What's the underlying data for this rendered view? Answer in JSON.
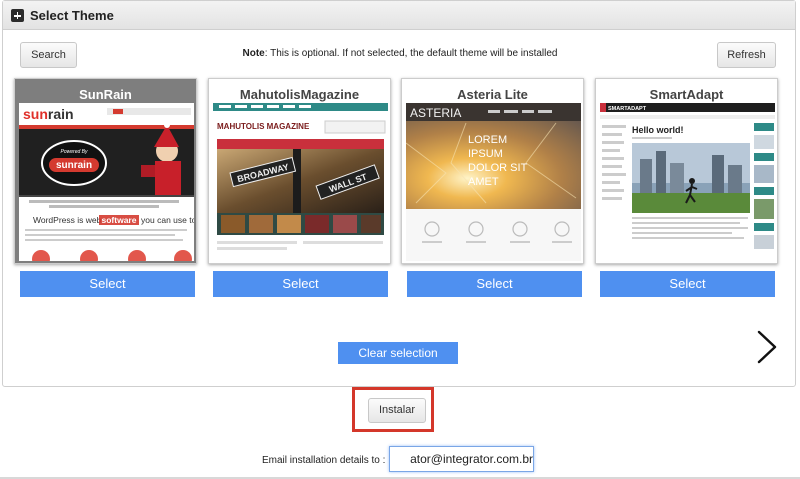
{
  "panel": {
    "title": "Select Theme"
  },
  "toolbar": {
    "search_label": "Search",
    "refresh_label": "Refresh",
    "note_label": "Note",
    "note_text": ": This is optional. If not selected, the default theme will be installed"
  },
  "themes": [
    {
      "name": "SunRain",
      "select_label": "Select",
      "selected": true,
      "preview": {
        "logo_left": "sun",
        "logo_right": "rain",
        "badge": "sunrain",
        "badge_caption": "Powered By",
        "headline_start": "WordPress is web ",
        "headline_highlight": "software",
        "headline_end": " you can use to create w"
      }
    },
    {
      "name": "MahutolisMagazine",
      "select_label": "Select",
      "selected": false,
      "preview": {
        "logo": "MAHUTOLIS MAGAZINE",
        "sign_1": "BROADWAY",
        "sign_2": "WALL ST"
      }
    },
    {
      "name": "Asteria Lite",
      "select_label": "Select",
      "selected": false,
      "preview": {
        "logo": "ASTERIA",
        "hero_lines": [
          "LOREM",
          "IPSUM",
          "DOLOR SIT",
          "AMET"
        ]
      }
    },
    {
      "name": "SmartAdapt",
      "select_label": "Select",
      "selected": false,
      "preview": {
        "logo": "SMARTADAPT",
        "post_title": "Hello world!"
      }
    }
  ],
  "actions": {
    "clear_label": "Clear selection",
    "install_label": "Instalar",
    "email_label": "Email installation details to :",
    "email_value": "ator@integrator.com.br"
  },
  "colors": {
    "accent_blue": "#4f90f0",
    "highlight_red": "#d4372a",
    "selected_card": "#7e7e7e"
  },
  "icons": {
    "panel_toggle": "plus-icon",
    "carousel_next": "chevron-right-icon"
  }
}
